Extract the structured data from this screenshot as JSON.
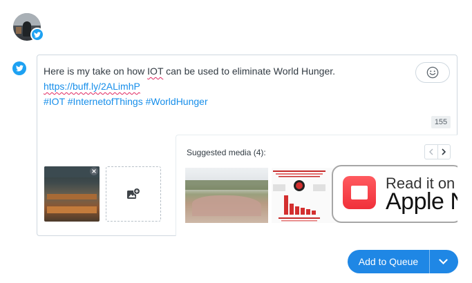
{
  "post": {
    "text_line1_before": "Here is my take on how ",
    "text_line1_misspelled": "IOT",
    "text_line1_after": " can be used to eliminate World Hunger.",
    "link": "https://buff.ly/2ALimhP",
    "hashtags": "#IOT #InternetofThings #WorldHunger",
    "char_count": "155"
  },
  "suggested_media": {
    "label": "Suggested media (4):",
    "items": [
      {
        "icon": "landfill-photo"
      },
      {
        "icon": "food-waste-infographic"
      },
      {
        "title_line1": "Read it on",
        "title_line2": "Apple N"
      }
    ]
  },
  "actions": {
    "add_to_queue_label": "Add to Queue"
  },
  "colors": {
    "accent": "#1f87e5",
    "twitter_blue": "#1da1f2",
    "link": "#168eea"
  }
}
